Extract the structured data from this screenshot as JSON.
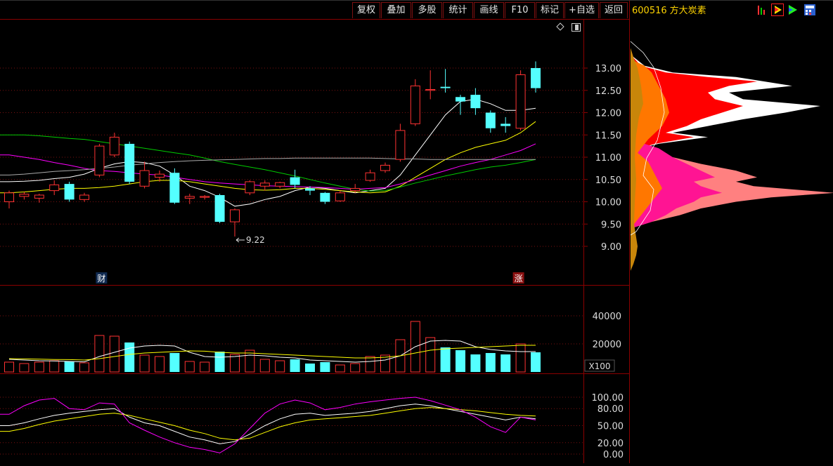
{
  "toolbar": {
    "buttons": [
      "复权",
      "叠加",
      "多股",
      "统计",
      "画线",
      "F10",
      "标记",
      "+自选",
      "返回"
    ]
  },
  "stock": {
    "code": "600516",
    "name": "方大炭素"
  },
  "colors": {
    "up": "#ff3232",
    "down": "#54ffff",
    "ma5": "#ffffff",
    "ma10": "#ffff00",
    "ma20": "#ff00ff",
    "ma60": "#00cc00",
    "ma120": "#aaaaaa",
    "frame": "#8b0000"
  },
  "chart_data": [
    {
      "type": "candlestick",
      "yticks": [
        "13.00",
        "12.50",
        "12.00",
        "11.50",
        "11.00",
        "10.50",
        "10.00",
        "9.50",
        "9.00"
      ],
      "ylim": [
        8.5,
        13.6
      ],
      "low_annotation": "9.22",
      "markers": [
        {
          "label": "财",
          "bar": 6
        },
        {
          "label": "涨",
          "bar": 34
        }
      ],
      "candles": [
        {
          "o": 10.0,
          "h": 10.25,
          "l": 9.85,
          "c": 10.2
        },
        {
          "o": 10.12,
          "h": 10.22,
          "l": 10.05,
          "c": 10.17
        },
        {
          "o": 10.08,
          "h": 10.18,
          "l": 9.98,
          "c": 10.15
        },
        {
          "o": 10.25,
          "h": 10.48,
          "l": 10.15,
          "c": 10.38
        },
        {
          "o": 10.4,
          "h": 10.45,
          "l": 10.0,
          "c": 10.05
        },
        {
          "o": 10.05,
          "h": 10.2,
          "l": 10.0,
          "c": 10.15
        },
        {
          "o": 10.6,
          "h": 11.3,
          "l": 10.55,
          "c": 11.25
        },
        {
          "o": 11.05,
          "h": 11.55,
          "l": 11.0,
          "c": 11.45
        },
        {
          "o": 11.3,
          "h": 11.35,
          "l": 10.4,
          "c": 10.45
        },
        {
          "o": 10.35,
          "h": 10.9,
          "l": 10.3,
          "c": 10.7
        },
        {
          "o": 10.55,
          "h": 10.7,
          "l": 10.45,
          "c": 10.62
        },
        {
          "o": 10.65,
          "h": 10.75,
          "l": 9.95,
          "c": 9.98
        },
        {
          "o": 10.08,
          "h": 10.18,
          "l": 9.95,
          "c": 10.12
        },
        {
          "o": 10.1,
          "h": 10.15,
          "l": 10.05,
          "c": 10.12
        },
        {
          "o": 10.15,
          "h": 10.18,
          "l": 9.52,
          "c": 9.55
        },
        {
          "o": 9.55,
          "h": 9.85,
          "l": 9.22,
          "c": 9.82
        },
        {
          "o": 10.2,
          "h": 10.48,
          "l": 10.15,
          "c": 10.45
        },
        {
          "o": 10.35,
          "h": 10.48,
          "l": 10.25,
          "c": 10.42
        },
        {
          "o": 10.35,
          "h": 10.45,
          "l": 10.3,
          "c": 10.43
        },
        {
          "o": 10.55,
          "h": 10.72,
          "l": 10.3,
          "c": 10.38
        },
        {
          "o": 10.3,
          "h": 10.35,
          "l": 10.15,
          "c": 10.25
        },
        {
          "o": 10.2,
          "h": 10.22,
          "l": 9.95,
          "c": 10.0
        },
        {
          "o": 10.02,
          "h": 10.25,
          "l": 10.0,
          "c": 10.2
        },
        {
          "o": 10.25,
          "h": 10.4,
          "l": 10.2,
          "c": 10.3
        },
        {
          "o": 10.48,
          "h": 10.72,
          "l": 10.45,
          "c": 10.65
        },
        {
          "o": 10.7,
          "h": 10.88,
          "l": 10.65,
          "c": 10.82
        },
        {
          "o": 10.95,
          "h": 11.75,
          "l": 10.9,
          "c": 11.6
        },
        {
          "o": 11.75,
          "h": 12.75,
          "l": 11.7,
          "c": 12.6
        },
        {
          "o": 12.5,
          "h": 12.95,
          "l": 12.3,
          "c": 12.52
        },
        {
          "o": 12.58,
          "h": 12.98,
          "l": 12.45,
          "c": 12.55
        },
        {
          "o": 12.35,
          "h": 12.4,
          "l": 11.95,
          "c": 12.25
        },
        {
          "o": 12.4,
          "h": 12.55,
          "l": 11.95,
          "c": 12.1
        },
        {
          "o": 12.0,
          "h": 12.05,
          "l": 11.55,
          "c": 11.65
        },
        {
          "o": 11.75,
          "h": 11.9,
          "l": 11.55,
          "c": 11.7
        },
        {
          "o": 11.65,
          "h": 12.95,
          "l": 11.6,
          "c": 12.85
        },
        {
          "o": 13.0,
          "h": 13.15,
          "l": 12.45,
          "c": 12.55
        }
      ],
      "ma_lines": [
        {
          "name": "MA5",
          "color": "#ffffff",
          "values": [
            10.45,
            10.46,
            10.48,
            10.52,
            10.55,
            10.62,
            10.75,
            10.85,
            10.9,
            10.88,
            10.8,
            10.6,
            10.35,
            10.25,
            10.1,
            9.9,
            9.95,
            10.05,
            10.12,
            10.25,
            10.33,
            10.3,
            10.25,
            10.2,
            10.25,
            10.3,
            10.6,
            11.05,
            11.5,
            11.95,
            12.25,
            12.3,
            12.2,
            12.05,
            12.05,
            12.1
          ]
        },
        {
          "name": "MA10",
          "color": "#ffff00",
          "values": [
            10.2,
            10.22,
            10.25,
            10.28,
            10.3,
            10.3,
            10.32,
            10.35,
            10.4,
            10.45,
            10.48,
            10.48,
            10.45,
            10.4,
            10.35,
            10.3,
            10.27,
            10.26,
            10.27,
            10.3,
            10.3,
            10.28,
            10.25,
            10.22,
            10.2,
            10.22,
            10.35,
            10.55,
            10.75,
            10.95,
            11.1,
            11.22,
            11.3,
            11.38,
            11.55,
            11.8
          ]
        },
        {
          "name": "MA20",
          "color": "#ff00ff",
          "values": [
            11.05,
            11.0,
            10.95,
            10.88,
            10.82,
            10.75,
            10.7,
            10.68,
            10.65,
            10.62,
            10.6,
            10.55,
            10.5,
            10.45,
            10.42,
            10.4,
            10.38,
            10.36,
            10.35,
            10.34,
            10.33,
            10.32,
            10.3,
            10.28,
            10.3,
            10.32,
            10.4,
            10.5,
            10.6,
            10.7,
            10.8,
            10.88,
            10.95,
            11.05,
            11.15,
            11.3
          ]
        },
        {
          "name": "MA60",
          "color": "#00cc00",
          "values": [
            11.5,
            11.5,
            11.48,
            11.45,
            11.42,
            11.4,
            11.35,
            11.3,
            11.25,
            11.2,
            11.15,
            11.1,
            11.05,
            10.98,
            10.9,
            10.84,
            10.78,
            10.72,
            10.65,
            10.58,
            10.5,
            10.42,
            10.35,
            10.28,
            10.24,
            10.25,
            10.33,
            10.42,
            10.5,
            10.58,
            10.65,
            10.72,
            10.78,
            10.82,
            10.88,
            10.95
          ]
        },
        {
          "name": "MA120",
          "color": "#aaaaaa",
          "values": [
            10.6,
            10.62,
            10.65,
            10.68,
            10.7,
            10.72,
            10.75,
            10.78,
            10.82,
            10.85,
            10.88,
            10.9,
            10.92,
            10.93,
            10.94,
            10.95,
            10.96,
            10.97,
            10.97,
            10.98,
            10.98,
            10.98,
            10.98,
            10.98,
            10.98,
            10.97,
            10.96,
            10.96,
            10.95,
            10.95,
            10.95,
            10.95,
            10.95,
            10.95,
            10.95,
            10.95
          ]
        }
      ]
    },
    {
      "type": "bar",
      "name": "volume",
      "yticks": [
        "40000",
        "20000"
      ],
      "unit_label": "X100",
      "ylim": [
        0,
        50000
      ],
      "values": [
        7000,
        6000,
        7000,
        8000,
        7500,
        6500,
        26000,
        25500,
        21000,
        12000,
        11000,
        13500,
        7500,
        7000,
        14500,
        12500,
        15500,
        9000,
        8000,
        9000,
        6000,
        7000,
        5000,
        6000,
        11000,
        12000,
        23000,
        36000,
        24500,
        17500,
        15500,
        12500,
        13500,
        12500,
        20000,
        14000
      ],
      "ma_lines": [
        {
          "name": "VMA5",
          "color": "#ffffff",
          "values": [
            9000,
            8500,
            8000,
            7800,
            7500,
            7200,
            11000,
            14000,
            17000,
            18500,
            19000,
            18500,
            14000,
            11000,
            10500,
            11000,
            12000,
            11500,
            10500,
            10000,
            8500,
            8000,
            7500,
            7000,
            7500,
            8500,
            11500,
            18000,
            22000,
            22500,
            22000,
            18000,
            16000,
            15000,
            14500,
            14500
          ]
        },
        {
          "name": "VMA10",
          "color": "#ffff00",
          "values": [
            9500,
            9300,
            9100,
            8900,
            8800,
            8500,
            9500,
            11000,
            12500,
            13500,
            14000,
            14500,
            15000,
            14800,
            14000,
            13500,
            13500,
            13000,
            12500,
            12000,
            11500,
            11000,
            10500,
            10000,
            10000,
            10500,
            11500,
            13500,
            15500,
            16500,
            17000,
            17500,
            18000,
            18500,
            19000,
            19000
          ]
        }
      ]
    },
    {
      "type": "line",
      "name": "KDJ",
      "yticks": [
        "100.00",
        "80.00",
        "50.00",
        "20.00",
        "0.00"
      ],
      "ylim": [
        0,
        110
      ],
      "series": [
        {
          "name": "K",
          "color": "#ffffff",
          "values": [
            50,
            55,
            62,
            68,
            72,
            75,
            78,
            80,
            65,
            55,
            50,
            40,
            30,
            25,
            18,
            22,
            35,
            50,
            62,
            70,
            72,
            68,
            70,
            72,
            75,
            80,
            85,
            88,
            85,
            80,
            75,
            70,
            65,
            60,
            65,
            62
          ]
        },
        {
          "name": "D",
          "color": "#ffff00",
          "values": [
            40,
            45,
            52,
            58,
            62,
            66,
            70,
            72,
            68,
            62,
            56,
            50,
            42,
            36,
            28,
            25,
            28,
            38,
            48,
            55,
            60,
            62,
            64,
            66,
            68,
            72,
            76,
            80,
            82,
            80,
            78,
            76,
            73,
            70,
            68,
            67
          ]
        },
        {
          "name": "J",
          "color": "#ff00ff",
          "values": [
            70,
            85,
            95,
            98,
            80,
            78,
            90,
            88,
            55,
            42,
            30,
            20,
            12,
            8,
            2,
            18,
            45,
            72,
            88,
            95,
            90,
            78,
            82,
            88,
            92,
            95,
            98,
            100,
            94,
            86,
            78,
            65,
            48,
            38,
            65,
            60
          ]
        }
      ]
    },
    {
      "type": "area",
      "name": "chip-distribution",
      "ylim": [
        8.5,
        13.6
      ]
    }
  ]
}
